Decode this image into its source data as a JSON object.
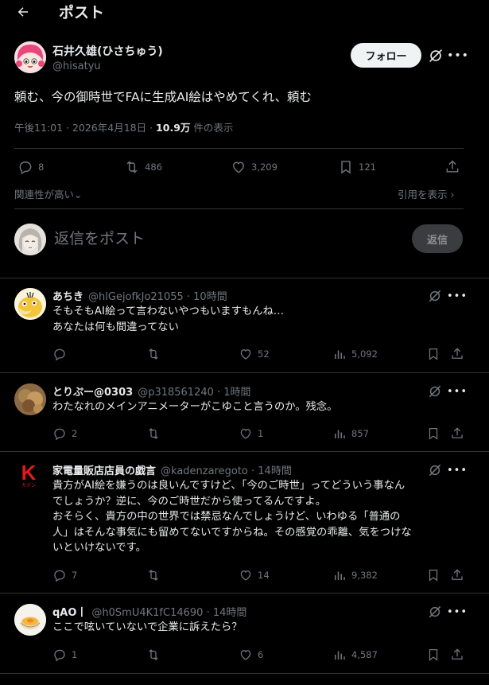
{
  "header": {
    "title": "ポスト"
  },
  "post": {
    "author_name": "石井久雄(ひさちゅう)",
    "author_handle": "@hisatyu",
    "follow_label": "フォロー",
    "text": "頼む、今の御時世でFAに生成AI絵はやめてくれ、頼む",
    "time": "午後11:01 · 2026年4月18日 · ",
    "views": "10.9万",
    "views_suffix": " 件の表示",
    "replies": "8",
    "reposts": "486",
    "likes": "3,209",
    "bookmarks": "121"
  },
  "sort": {
    "relevance_label": "関連性が高い",
    "quotes_label": "引用を表示"
  },
  "composer": {
    "placeholder": "返信をポスト",
    "reply_label": "返信"
  },
  "replies": [
    {
      "name": "あちき",
      "handle": "@hlGejofkJo21055 · 10時間",
      "lines": [
        "そもそもAI絵って言わないやつもいますもんね…",
        "あなたは何も間違ってない"
      ],
      "reply_count": "",
      "repost_count": "",
      "like_count": "52",
      "view_count": "5,092"
    },
    {
      "name": "とりぷー@0303",
      "handle": "@p318561240 · 1時間",
      "lines": [
        "わたなれのメインアニメーターがこゆこと言うのか。残念。"
      ],
      "reply_count": "2",
      "repost_count": "",
      "like_count": "1",
      "view_count": "857"
    },
    {
      "name": "家電量販店店員の戯言",
      "handle": "@kadenzaregoto · 14時間",
      "avatar_text": "K",
      "avatar_sub": "カデン",
      "lines": [
        "貴方がAI絵を嫌うのは良いんですけど、「今のご時世」ってどういう事なん",
        "でしょうか？逆に、今のご時世だから使ってるんですよ。",
        "おそらく、貴方の中の世界では禁忌なんでしょうけど、いわゆる「普通の",
        "人」はそんな事気にも留めてないですからね。その感覚の乖離、気をつけな",
        "いといけないです。"
      ],
      "reply_count": "7",
      "repost_count": "",
      "like_count": "14",
      "view_count": "9,382"
    },
    {
      "name": "qAO丨",
      "handle": "@h0SmU4K1fC14690 · 14時間",
      "lines": [
        "ここで呟いていないで企業に訴えたら？"
      ],
      "reply_count": "1",
      "repost_count": "",
      "like_count": "6",
      "view_count": "4,587"
    }
  ],
  "icons": {
    "back": "back-arrow-icon",
    "grok": "grok-icon",
    "more": "more-icon",
    "reply": "reply-icon",
    "repost": "repost-icon",
    "like": "like-icon",
    "bookmark": "bookmark-icon",
    "share": "share-icon",
    "views": "views-icon"
  },
  "colors": {
    "background": "#000000",
    "text": "#e7e9ea",
    "muted": "#71767b",
    "divider": "#2f3336",
    "brand_red": "#e0191e"
  }
}
